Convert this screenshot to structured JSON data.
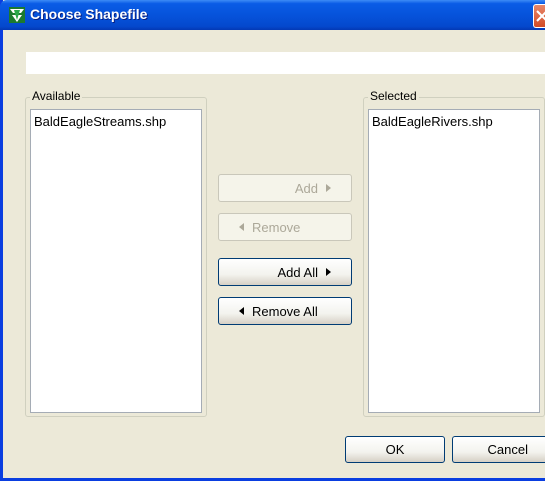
{
  "window": {
    "title": "Choose Shapefile",
    "title_bar_color": "#0653db"
  },
  "top_field": {
    "value": ""
  },
  "available": {
    "label": "Available",
    "items": [
      "BaldEagleStreams.shp"
    ]
  },
  "selected": {
    "label": "Selected",
    "items": [
      "BaldEagleRivers.shp"
    ]
  },
  "buttons": {
    "add": "Add",
    "remove": "Remove",
    "add_all": "Add All",
    "remove_all": "Remove All",
    "ok": "OK",
    "cancel": "Cancel"
  }
}
